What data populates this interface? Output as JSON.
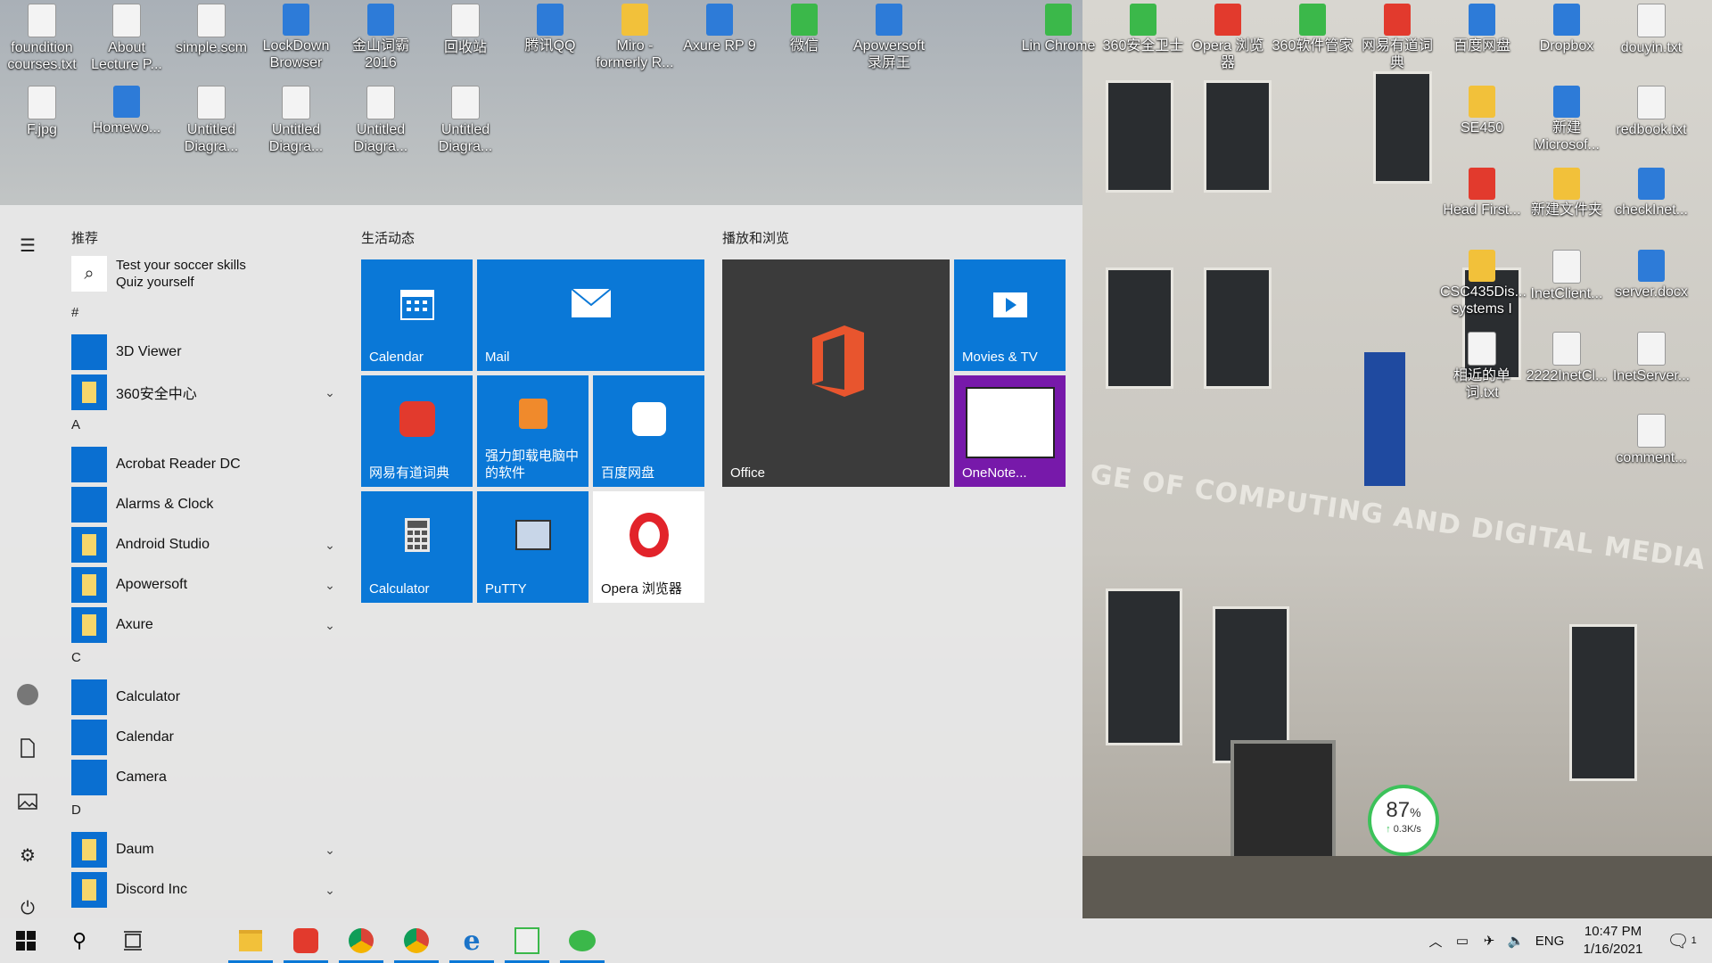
{
  "desktop": {
    "icons": [
      {
        "label": "foundition courses.txt",
        "kind": "doc"
      },
      {
        "label": "About Lecture P...",
        "kind": "doc"
      },
      {
        "label": "simple.scm",
        "kind": "doc"
      },
      {
        "label": "LockDown Browser",
        "kind": "app"
      },
      {
        "label": "金山词霸 2016",
        "kind": "app"
      },
      {
        "label": "回收站",
        "kind": "doc"
      },
      {
        "label": "腾讯QQ",
        "kind": "app"
      },
      {
        "label": "Miro - formerly R...",
        "kind": "yellow"
      },
      {
        "label": "Axure RP 9",
        "kind": "app"
      },
      {
        "label": "微信",
        "kind": "green"
      },
      {
        "label": "Apowersoft 录屏王",
        "kind": "app"
      },
      {
        "label": "Lin Chrome",
        "kind": "green"
      },
      {
        "label": "360安全卫士",
        "kind": "green"
      },
      {
        "label": "Opera 浏览器",
        "kind": "red"
      },
      {
        "label": "360软件管家",
        "kind": "green"
      },
      {
        "label": "网易有道词典",
        "kind": "red"
      },
      {
        "label": "百度网盘",
        "kind": "app"
      },
      {
        "label": "Dropbox",
        "kind": "app"
      },
      {
        "label": "douyin.txt",
        "kind": "doc"
      },
      {
        "label": "F.jpg",
        "kind": "doc"
      },
      {
        "label": "Homewo...",
        "kind": "app"
      },
      {
        "label": "Untitled Diagra...",
        "kind": "doc"
      },
      {
        "label": "Untitled Diagra...",
        "kind": "doc"
      },
      {
        "label": "Untitled Diagra...",
        "kind": "doc"
      },
      {
        "label": "Untitled Diagra...",
        "kind": "doc"
      },
      {
        "label": "SE450",
        "kind": "yellow"
      },
      {
        "label": "新建 Microsof...",
        "kind": "app"
      },
      {
        "label": "redbook.txt",
        "kind": "doc"
      },
      {
        "label": "Head First...",
        "kind": "red"
      },
      {
        "label": "新建文件夹",
        "kind": "yellow"
      },
      {
        "label": "checkInet...",
        "kind": "app"
      },
      {
        "label": "CSC435Dis... systems I",
        "kind": "yellow"
      },
      {
        "label": "InetClient...",
        "kind": "doc"
      },
      {
        "label": "server.docx",
        "kind": "app"
      },
      {
        "label": "相近的单词.txt",
        "kind": "doc"
      },
      {
        "label": "2222InetCl...",
        "kind": "doc"
      },
      {
        "label": "InetServer...",
        "kind": "doc"
      },
      {
        "label": "comment...",
        "kind": "doc"
      }
    ],
    "wallpaper_sign": "GE OF COMPUTING AND DIGITAL MEDIA",
    "gauge": {
      "value": "87",
      "unit": "%",
      "speed": "0.3K/s"
    }
  },
  "start_menu": {
    "recommended_title": "推荐",
    "suggestion": {
      "line1": "Test your soccer skills",
      "line2": "Quiz yourself"
    },
    "sections": [
      {
        "letter": "#",
        "items": [
          {
            "label": "3D Viewer",
            "expand": false
          },
          {
            "label": "360安全中心",
            "expand": true
          }
        ]
      },
      {
        "letter": "A",
        "items": [
          {
            "label": "Acrobat Reader DC",
            "expand": false
          },
          {
            "label": "Alarms & Clock",
            "expand": false
          },
          {
            "label": "Android Studio",
            "expand": true
          },
          {
            "label": "Apowersoft",
            "expand": true
          },
          {
            "label": "Axure",
            "expand": true
          }
        ]
      },
      {
        "letter": "C",
        "items": [
          {
            "label": "Calculator",
            "expand": false
          },
          {
            "label": "Calendar",
            "expand": false
          },
          {
            "label": "Camera",
            "expand": false
          }
        ]
      },
      {
        "letter": "D",
        "items": [
          {
            "label": "Daum",
            "expand": true
          },
          {
            "label": "Discord Inc",
            "expand": true
          }
        ]
      }
    ],
    "groups": [
      {
        "title": "生活动态"
      },
      {
        "title": "播放和浏览"
      }
    ],
    "tiles": {
      "calendar": "Calendar",
      "mail": "Mail",
      "youdao": "网易有道词典",
      "uninstall": "强力卸载电脑中的软件",
      "baidu": "百度网盘",
      "calculator": "Calculator",
      "putty": "PuTTY",
      "opera": "Opera 浏览器",
      "office": "Office",
      "movies": "Movies & TV",
      "onenote": "OneNote..."
    }
  },
  "taskbar": {
    "language": "ENG",
    "time": "10:47 PM",
    "date": "1/16/2021",
    "notification_count": "1"
  }
}
